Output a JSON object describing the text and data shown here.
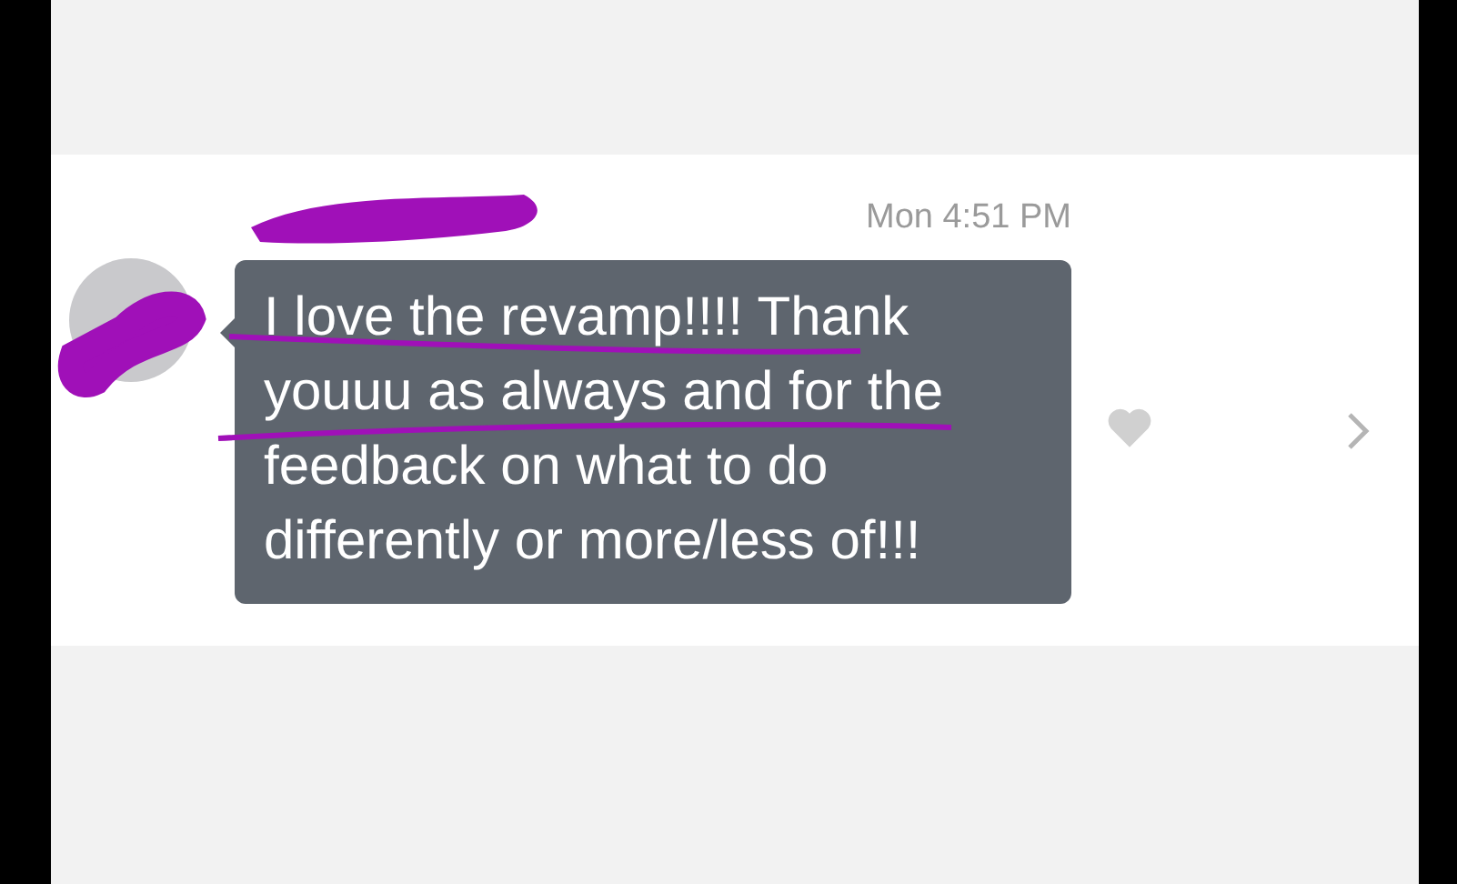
{
  "message": {
    "time": "Mon 4:51 PM",
    "text": "I love the revamp!!!! Thank youuu as always and for the feedback on what to do differently or more/less of!!!",
    "liked": false
  }
}
